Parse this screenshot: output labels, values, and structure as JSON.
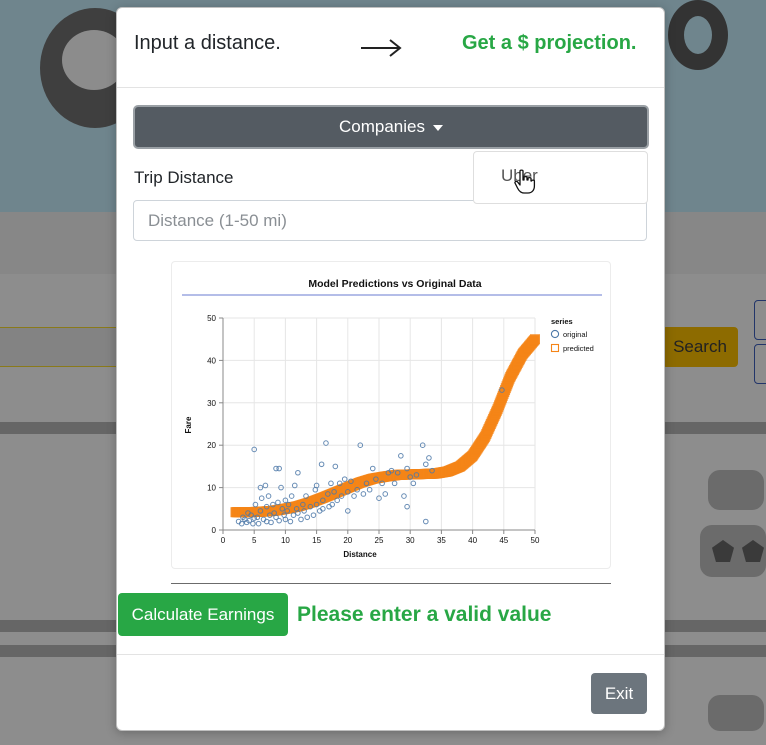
{
  "background": {
    "search_label": "Search"
  },
  "modal": {
    "header_left": "Input a distance.",
    "header_arrow_icon": "long-right-arrow-icon",
    "header_right": "Get a $ projection.",
    "dropdown_label": "Companies",
    "dropdown_items": [
      "Uber"
    ],
    "distance_label": "Trip Distance",
    "distance_placeholder": "Distance (1-50 mi)",
    "calculate_label": "Calculate Earnings",
    "status_text": "Please enter a valid value",
    "exit_label": "Exit",
    "colors": {
      "accent_green": "#28a745",
      "dropdown_bg": "#545b62",
      "exit_bg": "#6c757d"
    }
  },
  "chart_data": {
    "type": "scatter",
    "title": "Model Predictions vs Original Data",
    "xlabel": "Distance",
    "ylabel": "Fare",
    "xlim": [
      0,
      50
    ],
    "ylim": [
      0,
      50
    ],
    "xticks": [
      0,
      5,
      10,
      15,
      20,
      25,
      30,
      35,
      40,
      45,
      50
    ],
    "yticks": [
      0,
      10,
      20,
      30,
      40,
      50
    ],
    "grid": true,
    "legend_title": "series",
    "legend_position": "top-right",
    "series": [
      {
        "name": "original",
        "color": "#4c78a8",
        "marker": "circle",
        "points": [
          [
            2.5,
            2
          ],
          [
            3,
            1.5
          ],
          [
            3.2,
            3
          ],
          [
            3.5,
            2.5
          ],
          [
            3.8,
            1.8
          ],
          [
            4,
            4
          ],
          [
            4.2,
            2.2
          ],
          [
            4.5,
            3.5
          ],
          [
            4.8,
            1.5
          ],
          [
            5,
            2.8
          ],
          [
            5,
            19
          ],
          [
            5.2,
            6
          ],
          [
            5.5,
            3
          ],
          [
            5.7,
            1.5
          ],
          [
            6,
            10
          ],
          [
            6,
            4.5
          ],
          [
            6.2,
            7.5
          ],
          [
            6.5,
            2.5
          ],
          [
            6.8,
            10.5
          ],
          [
            7,
            5.5
          ],
          [
            7,
            2
          ],
          [
            7.3,
            8
          ],
          [
            7.5,
            3.5
          ],
          [
            7.7,
            1.8
          ],
          [
            8,
            6
          ],
          [
            8.2,
            4
          ],
          [
            8.5,
            14.5
          ],
          [
            8.5,
            3
          ],
          [
            8.8,
            6.5
          ],
          [
            9,
            14.5
          ],
          [
            9,
            2.2
          ],
          [
            9.3,
            10
          ],
          [
            9.5,
            5
          ],
          [
            9.8,
            3.5
          ],
          [
            10,
            7
          ],
          [
            10,
            2.5
          ],
          [
            10.3,
            4.5
          ],
          [
            10.5,
            6
          ],
          [
            10.8,
            2
          ],
          [
            11,
            8
          ],
          [
            11.3,
            3.5
          ],
          [
            11.5,
            10.5
          ],
          [
            11.8,
            5
          ],
          [
            12,
            4
          ],
          [
            12,
            13.5
          ],
          [
            12.5,
            2.5
          ],
          [
            12.8,
            6
          ],
          [
            13,
            4.5
          ],
          [
            13.3,
            8
          ],
          [
            13.5,
            3
          ],
          [
            14,
            5.5
          ],
          [
            14.5,
            3.5
          ],
          [
            14.8,
            9.5
          ],
          [
            15,
            6
          ],
          [
            15,
            10.5
          ],
          [
            15.5,
            4.5
          ],
          [
            15.8,
            15.5
          ],
          [
            16,
            7
          ],
          [
            16,
            5
          ],
          [
            16.5,
            20.5
          ],
          [
            16.8,
            8.5
          ],
          [
            17,
            5.5
          ],
          [
            17.3,
            11
          ],
          [
            17.5,
            6
          ],
          [
            17.8,
            9
          ],
          [
            18,
            15
          ],
          [
            18.3,
            7
          ],
          [
            18.7,
            11
          ],
          [
            19,
            8
          ],
          [
            19.5,
            12
          ],
          [
            20,
            9
          ],
          [
            20,
            4.5
          ],
          [
            20.5,
            11.5
          ],
          [
            21,
            8
          ],
          [
            21.5,
            9.5
          ],
          [
            22,
            20
          ],
          [
            22.5,
            8.5
          ],
          [
            23,
            11
          ],
          [
            23.5,
            9.5
          ],
          [
            24,
            14.5
          ],
          [
            24.5,
            12
          ],
          [
            25,
            7.5
          ],
          [
            25.5,
            11
          ],
          [
            26,
            8.5
          ],
          [
            26.5,
            13.5
          ],
          [
            27,
            14
          ],
          [
            27.5,
            11
          ],
          [
            28,
            13.5
          ],
          [
            28.5,
            17.5
          ],
          [
            29,
            8
          ],
          [
            29.5,
            14.5
          ],
          [
            30,
            12.5
          ],
          [
            30.5,
            11
          ],
          [
            31,
            13
          ],
          [
            32,
            20
          ],
          [
            32.5,
            15.5
          ],
          [
            33,
            17
          ],
          [
            33.5,
            14
          ],
          [
            32.5,
            2
          ],
          [
            29.5,
            5.5
          ],
          [
            44.7,
            33
          ]
        ]
      },
      {
        "name": "predicted",
        "color": "#f58518",
        "marker": "square",
        "curve_x": [
          2,
          4,
          6,
          8,
          10,
          12,
          14,
          16,
          18,
          20,
          22,
          24,
          26,
          28,
          30,
          32,
          34,
          36,
          38,
          40,
          42,
          44,
          46,
          48,
          50
        ],
        "curve_y": [
          4.2,
          4.2,
          4.3,
          4.5,
          5,
          5.6,
          6.5,
          7.6,
          8.8,
          10,
          11.2,
          12.1,
          12.6,
          13,
          13.1,
          13.2,
          13.3,
          13.8,
          15,
          17.5,
          22,
          28.5,
          36,
          41.5,
          45
        ]
      }
    ]
  }
}
